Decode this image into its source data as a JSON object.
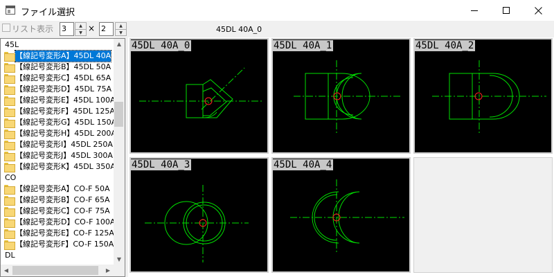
{
  "window": {
    "title": "ファイル選択",
    "icons": {
      "app": "application-window-icon",
      "minimize": "minimize-icon",
      "maximize": "maximize-icon",
      "close": "close-icon"
    }
  },
  "toolbar": {
    "list_display_label": "リスト表示",
    "list_display_checked": false,
    "columns_value": "3",
    "times": "×",
    "rows_value": "2",
    "selected_name": "45DL 40A_0"
  },
  "tree": {
    "rows": [
      {
        "type": "group",
        "label": "45L"
      },
      {
        "type": "item",
        "label": "【線記号変形A】45DL 40A",
        "selected": true
      },
      {
        "type": "item",
        "label": "【線記号変形B】45DL 50A"
      },
      {
        "type": "item",
        "label": "【線記号変形C】45DL 65A"
      },
      {
        "type": "item",
        "label": "【線記号変形D】45DL 75A"
      },
      {
        "type": "item",
        "label": "【線記号変形E】45DL 100A"
      },
      {
        "type": "item",
        "label": "【線記号変形F】45DL 125A"
      },
      {
        "type": "item",
        "label": "【線記号変形G】45DL 150A"
      },
      {
        "type": "item",
        "label": "【線記号変形H】45DL 200A"
      },
      {
        "type": "item",
        "label": "【線記号変形I】45DL 250A"
      },
      {
        "type": "item",
        "label": "【線記号変形J】45DL 300A"
      },
      {
        "type": "item",
        "label": "【線記号変形K】45DL 350A"
      },
      {
        "type": "group",
        "label": "CO"
      },
      {
        "type": "item",
        "label": "【線記号変形A】CO-F 50A"
      },
      {
        "type": "item",
        "label": "【線記号変形B】CO-F 65A"
      },
      {
        "type": "item",
        "label": "【線記号変形C】CO-F 75A"
      },
      {
        "type": "item",
        "label": "【線記号変形D】CO-F 100A"
      },
      {
        "type": "item",
        "label": "【線記号変形E】CO-F 125A"
      },
      {
        "type": "item",
        "label": "【線記号変形F】CO-F 150A"
      },
      {
        "type": "group",
        "label": "DL"
      }
    ]
  },
  "thumbnails": [
    {
      "label": "45DL 40A_0"
    },
    {
      "label": "45DL 40A_1"
    },
    {
      "label": "45DL 40A_2"
    },
    {
      "label": "45DL 40A_3"
    },
    {
      "label": "45DL 40A_4"
    }
  ],
  "colors": {
    "selection": "#0078d7",
    "canvas": "#000000",
    "drawing_line": "#00e000",
    "marker": "#ff2020",
    "label_bg": "#c8c8c8"
  }
}
